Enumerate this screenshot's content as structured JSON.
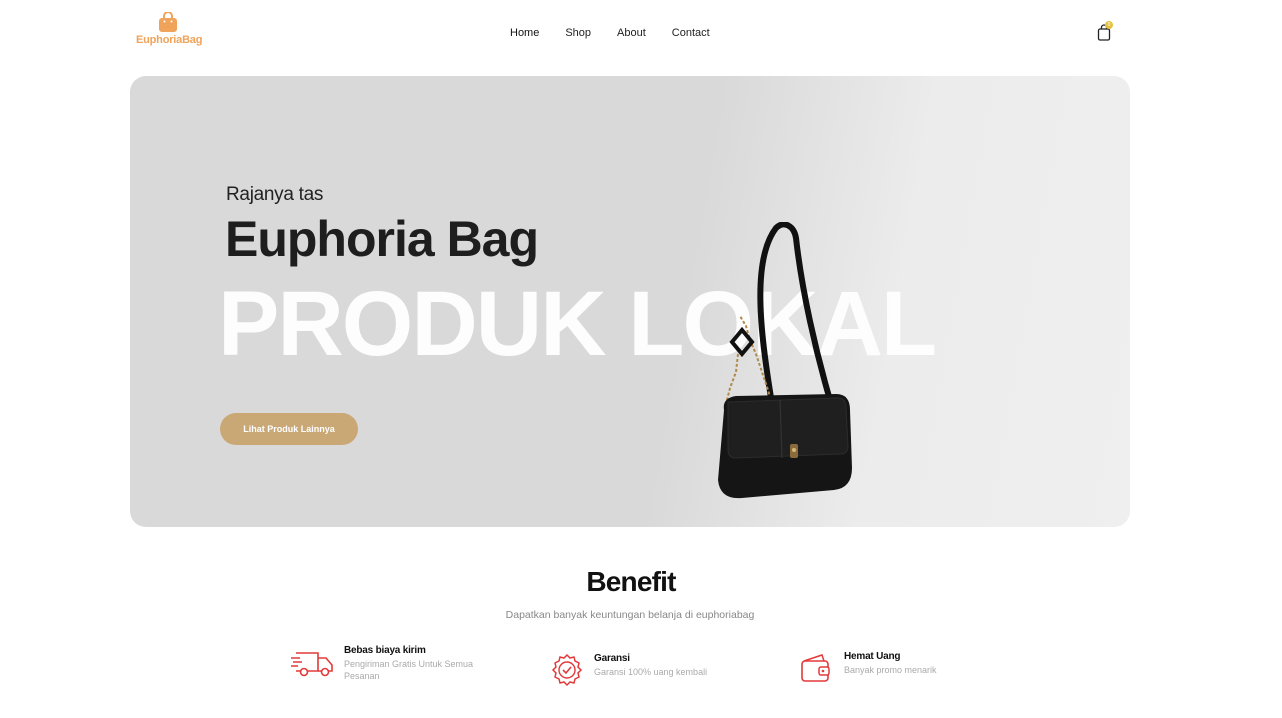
{
  "brand": {
    "name": "EuphoriaBag",
    "accent": "#f0a35a"
  },
  "nav": {
    "items": [
      "Home",
      "Shop",
      "About",
      "Contact"
    ]
  },
  "cart": {
    "count": "0"
  },
  "hero": {
    "subtitle": "Rajanya tas",
    "title": "Euphoria Bag",
    "background_word": "PRODUK LOKAL",
    "button_label": "Lihat Produk Lainnya",
    "button_color": "#c9a876"
  },
  "benefit": {
    "title": "Benefit",
    "description": "Dapatkan banyak keuntungan belanja di euphoriabag",
    "items": [
      {
        "icon": "delivery-truck-icon",
        "title": "Bebas biaya kirim",
        "desc": "Pengiriman Gratis Untuk Semua Pesanan"
      },
      {
        "icon": "warranty-badge-icon",
        "title": "Garansi",
        "desc": "Garansi 100% uang kembali"
      },
      {
        "icon": "wallet-icon",
        "title": "Hemat Uang",
        "desc": "Banyak promo menarik"
      }
    ],
    "icon_color": "#e23a3a"
  }
}
